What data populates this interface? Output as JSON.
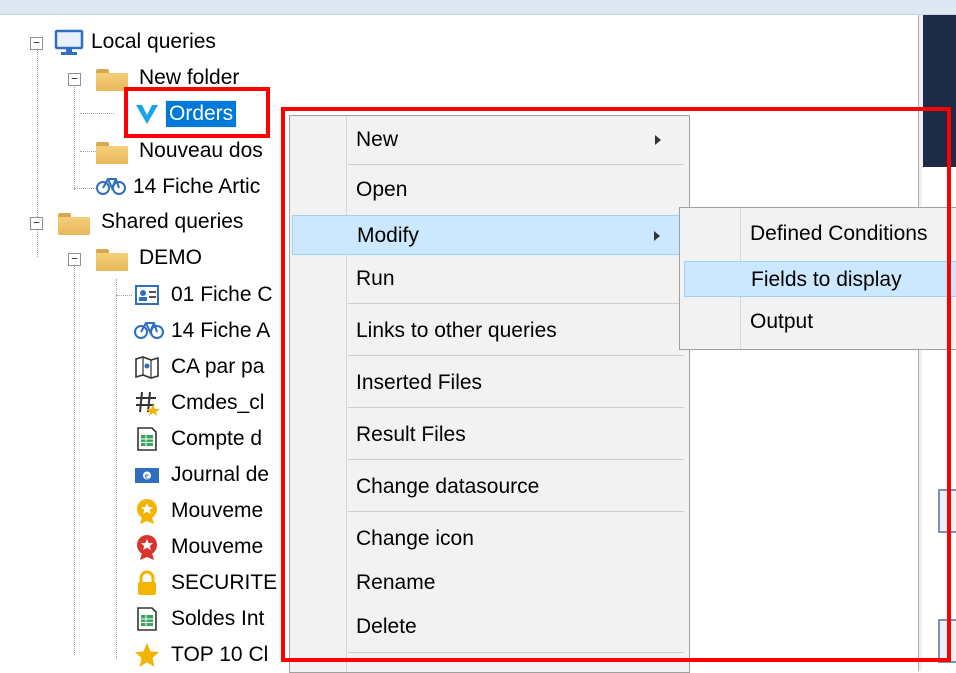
{
  "tree": {
    "local_queries": "Local queries",
    "new_folder": "New folder",
    "orders": "Orders",
    "nouveau_dossier": "Nouveau dos",
    "fiche_article": "14 Fiche Artic",
    "shared_queries": "Shared queries",
    "demo": "DEMO",
    "demo_items": [
      {
        "label": "01 Fiche C",
        "icon": "contact-card-icon"
      },
      {
        "label": "14 Fiche A",
        "icon": "bicycle-icon"
      },
      {
        "label": "CA par pa",
        "icon": "map-icon"
      },
      {
        "label": "Cmdes_cl",
        "icon": "hash-star-icon"
      },
      {
        "label": "Compte d",
        "icon": "spreadsheet-icon"
      },
      {
        "label": "Journal de",
        "icon": "banknote-icon"
      },
      {
        "label": "Mouveme",
        "icon": "badge-yellow-icon"
      },
      {
        "label": "Mouveme",
        "icon": "badge-red-icon"
      },
      {
        "label": "SECURITE",
        "icon": "padlock-icon"
      },
      {
        "label": "Soldes Int",
        "icon": "spreadsheet-icon"
      },
      {
        "label": "TOP 10 Cl",
        "icon": "star-icon"
      }
    ]
  },
  "context_menu": {
    "items": [
      "New",
      "Open",
      "Modify",
      "Run",
      "Links to other queries",
      "Inserted Files",
      "Result Files",
      "Change datasource",
      "Change icon",
      "Rename",
      "Delete"
    ],
    "highlighted": "Modify"
  },
  "submenu": {
    "items": [
      "Defined Conditions",
      "Fields to display",
      "Output"
    ],
    "highlighted": "Fields to display"
  },
  "colors": {
    "selection": "#0078d7",
    "menu_highlight": "#cce8ff",
    "annotation": "#ff0000",
    "folder": "#f5cf7a"
  }
}
